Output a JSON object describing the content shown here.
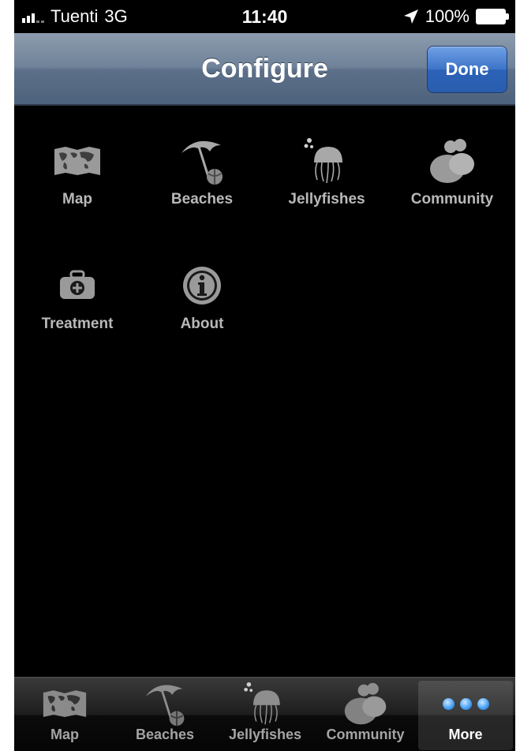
{
  "status_bar": {
    "carrier": "Tuenti",
    "network": "3G",
    "time": "11:40",
    "battery": "100%"
  },
  "navbar": {
    "title": "Configure",
    "done_label": "Done"
  },
  "grid": {
    "items": [
      {
        "label": "Map",
        "icon": "world-map-icon"
      },
      {
        "label": "Beaches",
        "icon": "beach-umbrella-icon"
      },
      {
        "label": "Jellyfishes",
        "icon": "jellyfish-icon"
      },
      {
        "label": "Community",
        "icon": "community-icon"
      },
      {
        "label": "Treatment",
        "icon": "first-aid-kit-icon"
      },
      {
        "label": "About",
        "icon": "info-icon"
      }
    ]
  },
  "tabbar": {
    "tabs": [
      {
        "label": "Map",
        "icon": "world-map-icon"
      },
      {
        "label": "Beaches",
        "icon": "beach-umbrella-icon"
      },
      {
        "label": "Jellyfishes",
        "icon": "jellyfish-icon"
      },
      {
        "label": "Community",
        "icon": "community-icon"
      },
      {
        "label": "More",
        "icon": "more-dots-icon"
      }
    ],
    "selected": "More"
  },
  "colors": {
    "icon_gray": "#9a9a9a",
    "label_gray": "#b9b9b9",
    "accent_blue": "#3d74c7"
  }
}
